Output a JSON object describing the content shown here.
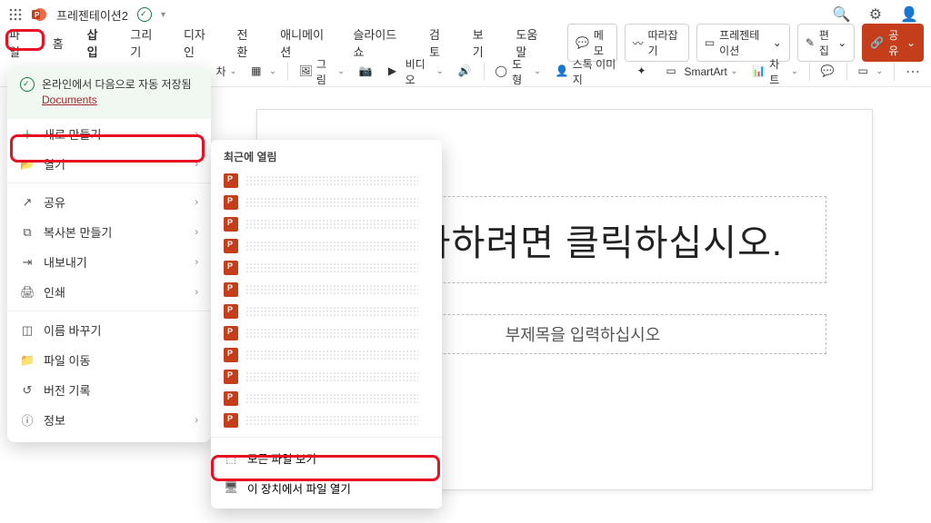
{
  "title": {
    "doc_name": "프레젠테이션2"
  },
  "tabs": {
    "file": "파일",
    "home": "홈",
    "insert": "삽입",
    "draw": "그리기",
    "design": "디자인",
    "transitions": "전환",
    "animations": "애니메이션",
    "slideshow": "슬라이드 쇼",
    "review": "검토",
    "view": "보기",
    "help": "도움말",
    "memo": "메모",
    "follow": "따라잡기",
    "present": "프레젠테이션",
    "edit": "편집",
    "share": "공유"
  },
  "toolbar": {
    "cha": "차",
    "drawing": "그림",
    "video": "비디오",
    "shape": "도형",
    "stock": "스톡 이미지",
    "smartart": "SmartArt",
    "chart": "차트"
  },
  "file_menu": {
    "save_caption": "온라인에서 다음으로 자동 저장됨",
    "documents": "Documents",
    "new": "새로 만들기",
    "open": "열기",
    "share": "공유",
    "copy": "복사본 만들기",
    "export": "내보내기",
    "print": "인쇄",
    "rename": "이름 바꾸기",
    "move": "파일 이동",
    "history": "버전 기록",
    "info": "정보"
  },
  "open_sub": {
    "header": "최근에 열림",
    "view_all": "모든 파일 보기",
    "open_device": "이 장치에서 파일 열기"
  },
  "slide": {
    "title_placeholder": "추가하려면 클릭하십시오.",
    "subtitle_placeholder": "부제목을 입력하십시오"
  }
}
